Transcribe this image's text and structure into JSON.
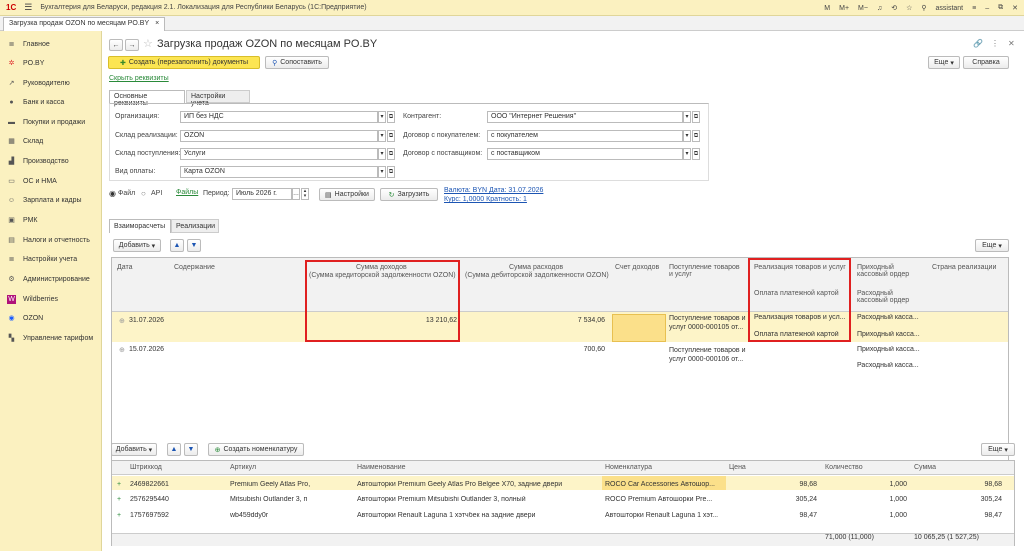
{
  "app": {
    "title": "Бухгалтерия для Беларуси, редакция 2.1. Локализация для Республики Беларусь (1С:Предприятие)",
    "user": "assistant",
    "m": "M",
    "mplus": "M+",
    "mminus": "M−"
  },
  "tab": {
    "label": "Загрузка продаж OZON по месяцам PO.BY",
    "close": "×"
  },
  "sidebar": [
    "Главное",
    "PO.BY",
    "Руководителю",
    "Банк и касса",
    "Покупки и продажи",
    "Склад",
    "Производство",
    "ОС и НМА",
    "Зарплата и кадры",
    "РМК",
    "Налоги и отчетность",
    "Настройки учета",
    "Администрирование",
    "Wildberries",
    "OZON",
    "Управление тарифом"
  ],
  "form": {
    "title": "Загрузка продаж OZON по месяцам PO.BY",
    "create_btn": "Создать (перезаполнить) документы",
    "match_btn": "Сопоставить",
    "more": "Еще",
    "help": "Справка",
    "hide_link": "Скрыть реквизиты",
    "tabs": [
      "Основные реквизиты",
      "Настройки учета"
    ],
    "org_label": "Организация:",
    "org": "ИП без НДС",
    "sklad_real_label": "Склад реализации:",
    "sklad_real": "OZON",
    "sklad_post_label": "Склад поступления:",
    "sklad_post": "Услуги",
    "pay_label": "Вид оплаты:",
    "pay": "Карта OZON",
    "kontr_label": "Контрагент:",
    "kontr": "ООО \"Интернет Решения\"",
    "dog_pok_label": "Договор с покупателем:",
    "dog_pok": "с покупателем",
    "dog_post_label": "Договор с поставщиком:",
    "dog_post": "с поставщиком",
    "file_label": "Файл",
    "api_label": "API",
    "files_link": "Файлы",
    "period_label": "Период:",
    "period": "Июль 2026 г.",
    "settings_btn": "Настройки",
    "load_btn": "Загрузить",
    "currency": "Валюта: BYN Дата: 31.07.2026",
    "rate": "Курс: 1,0000 Кратность: 1"
  },
  "tabs2": [
    "Взаиморасчеты",
    "Реализации"
  ],
  "add": "Добавить",
  "table1": {
    "headers": {
      "date": "Дата",
      "content": "Содержание",
      "income1": "Сумма доходов",
      "income2": "(Сумма кредиторской задолженности OZON)",
      "exp1": "Сумма расходов",
      "exp2": "(Сумма дебиторской задолженности OZON)",
      "acc": "Счет доходов",
      "post": "Поступление товаров и услуг",
      "real": "Реализация товаров и услуг",
      "pay": "Оплата платежной картой",
      "pko": "Приходный кассовый ордер",
      "rko": "Расходный кассовый ордер",
      "country": "Страна реализации"
    },
    "rows": [
      {
        "date": "31.07.2026",
        "income": "13 210,62",
        "exp": "7 534,06",
        "post": "Поступление товаров и услуг 0000-000105 от...",
        "real": "Реализация товаров и усл...",
        "pay": "Оплата платежной картой",
        "rko": "Расходный касса...",
        "pko": "Приходный касса..."
      },
      {
        "date": "15.07.2026",
        "income": "",
        "exp": "700,60",
        "post": "Поступление товаров и услуг 0000-000106 от...",
        "real": "",
        "pay": "",
        "rko": "Приходный касса...",
        "pko": "Расходный касса..."
      }
    ]
  },
  "table2": {
    "create_nom": "Создать номенклатуру",
    "headers": [
      "Штрихкод",
      "Артикул",
      "Наименование",
      "Номенклатура",
      "Цена",
      "Количество",
      "Сумма"
    ],
    "rows": [
      [
        "2469822661",
        "Premium Geely Atlas Pro,",
        "Автошторки Premium Geely Atlas Pro Belgee X70, задние двери",
        "ROCO Car Accessories Автошор...",
        "98,68",
        "1,000",
        "98,68"
      ],
      [
        "2576295440",
        "Mitsubishi Outlander 3, п",
        "Автошторки Premium Mitsubishi Outlander 3, полный",
        "ROCO Premium Автошорки Pre...",
        "305,24",
        "1,000",
        "305,24"
      ],
      [
        "1757697592",
        "wb459ddy0r",
        "Автошторки Renault Laguna 1 хэтчбек на задние двери",
        "Автошторки Renault Laguna 1 хэт...",
        "98,47",
        "1,000",
        "98,47"
      ]
    ],
    "total_qty": "71,000 (11,000)",
    "total_sum": "10 065,25 (1 527,25)"
  }
}
